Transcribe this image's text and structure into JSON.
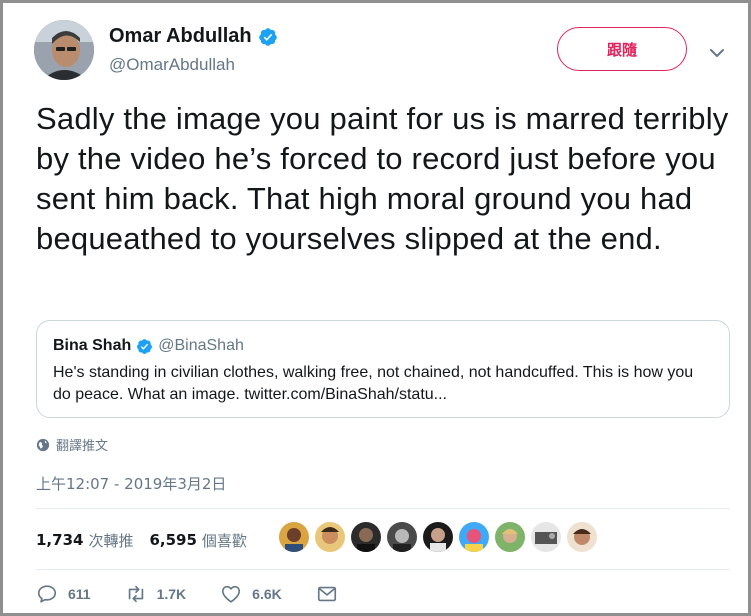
{
  "author": {
    "name": "Omar Abdullah",
    "handle": "@OmarAbdullah",
    "verified": true
  },
  "follow_button": {
    "label": "跟隨"
  },
  "tweet": {
    "text": "Sadly the image you paint for us is marred terribly by the video he’s forced to record just before you sent him back. That high moral ground you had bequeathed to yourselves slipped at the end."
  },
  "quote": {
    "name": "Bina Shah",
    "handle": "@BinaShah",
    "verified": true,
    "text": "He's standing in civilian clothes, walking free, not chained, not handcuffed. This is how you do peace. What an image. twitter.com/BinaShah/statu..."
  },
  "translate": {
    "label": "翻譯推文",
    "icon": "globe-icon"
  },
  "timestamp": "上午12:07 - 2019年3月2日",
  "stats": {
    "retweets": {
      "count": "1,734",
      "label": "次轉推"
    },
    "likes": {
      "count": "6,595",
      "label": "個喜歡"
    }
  },
  "actions": {
    "replies": "611",
    "retweets": "1.7K",
    "likes": "6.6K"
  },
  "colors": {
    "accent": "#1da1f2",
    "follow": "#e0245e",
    "secondary_text": "#657786",
    "border": "#ccd6dd"
  }
}
